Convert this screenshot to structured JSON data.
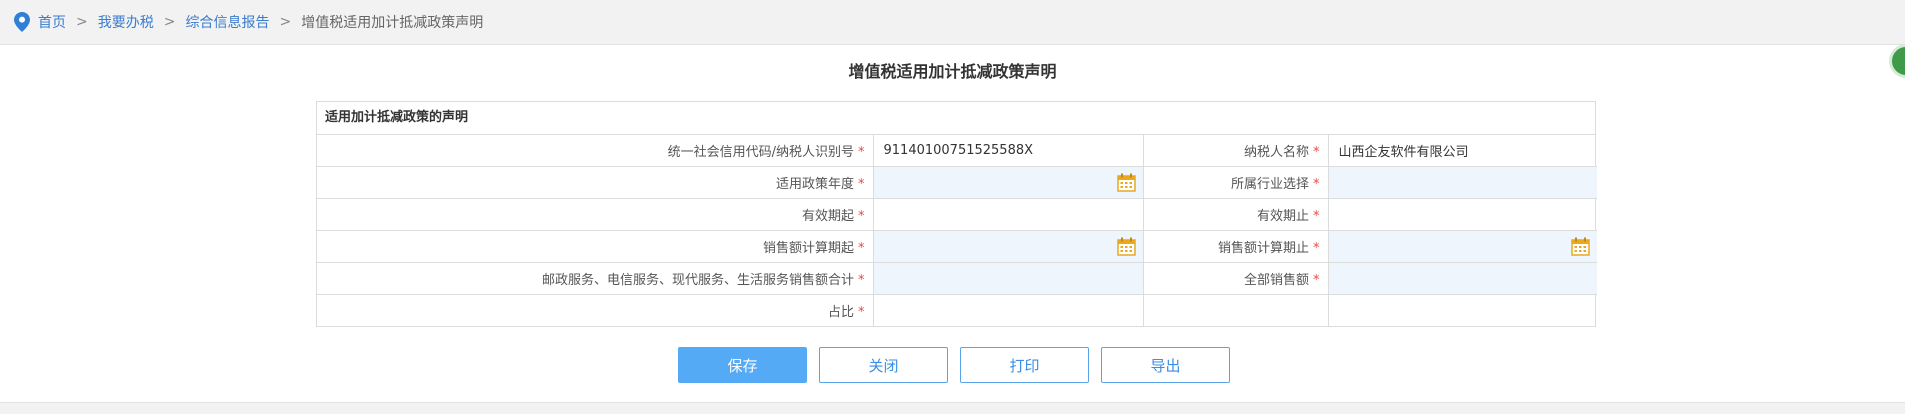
{
  "breadcrumb": {
    "items": [
      {
        "label": "首页",
        "link": true
      },
      {
        "label": "我要办税",
        "link": true
      },
      {
        "label": "综合信息报告",
        "link": true
      },
      {
        "label": "增值税适用加计抵减政策声明",
        "link": false
      }
    ],
    "separator": ">"
  },
  "page": {
    "title": "增值税适用加计抵减政策声明",
    "section_title": "适用加计抵减政策的声明"
  },
  "form": {
    "required_mark": "*",
    "rows": [
      {
        "left_label": "统一社会信用代码/纳税人识别号",
        "left_value": "91140100751525588X",
        "right_label": "纳税人名称",
        "right_value": "山西企友软件有限公司"
      },
      {
        "left_label": "适用政策年度",
        "left_value": "",
        "right_label": "所属行业选择",
        "right_value": ""
      },
      {
        "left_label": "有效期起",
        "left_value": "",
        "right_label": "有效期止",
        "right_value": ""
      },
      {
        "left_label": "销售额计算期起",
        "left_value": "",
        "right_label": "销售额计算期止",
        "right_value": ""
      },
      {
        "left_label": "邮政服务、电信服务、现代服务、生活服务销售额合计",
        "left_value": "",
        "right_label": "全部销售额",
        "right_value": ""
      },
      {
        "left_label": "占比",
        "left_value": ""
      }
    ]
  },
  "buttons": {
    "save": "保存",
    "close": "关闭",
    "print": "打印",
    "export": "导出"
  },
  "colors": {
    "accent": "#55aaf5",
    "link": "#3a7ccf",
    "required": "#e84a4a",
    "editable_bg": "#eef5fd",
    "calendar": "#e8a91e"
  },
  "icons": [
    "location-pin-icon",
    "calendar-icon"
  ]
}
